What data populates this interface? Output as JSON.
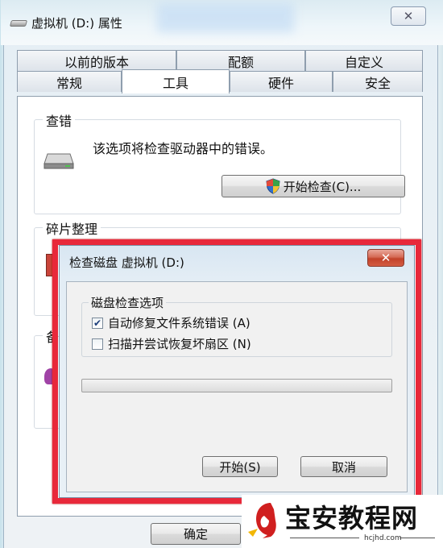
{
  "window": {
    "title": "虚拟机 (D:) 属性",
    "close_symbol": "✕"
  },
  "tabs": {
    "row1": [
      "以前的版本",
      "配额",
      "自定义"
    ],
    "row2": [
      "常规",
      "工具",
      "硬件",
      "安全"
    ],
    "active": "工具"
  },
  "error_check": {
    "group_label": "查错",
    "description": "该选项将检查驱动器中的错误。",
    "button_label": "开始检查(C)...",
    "icon": "drive-icon",
    "button_icon": "uac-shield-icon"
  },
  "defrag": {
    "group_label": "碎片整理"
  },
  "backup": {
    "group_label": "备"
  },
  "ok_button": "确定",
  "check_dialog": {
    "title": "检查磁盘 虚拟机 (D:)",
    "close_symbol": "✕",
    "options_label": "磁盘检查选项",
    "option1_label": "自动修复文件系统错误 (A)",
    "option1_checked": true,
    "option2_label": "扫描并尝试恢复坏扇区 (N)",
    "option2_checked": false,
    "progress": 0,
    "start_button": "开始(S)",
    "cancel_button": "取消",
    "highlight_color": "#e8283a"
  },
  "watermark": {
    "name": "宝安教程网",
    "url": "hcjhd.com",
    "brand_color": "#d01f1f"
  }
}
